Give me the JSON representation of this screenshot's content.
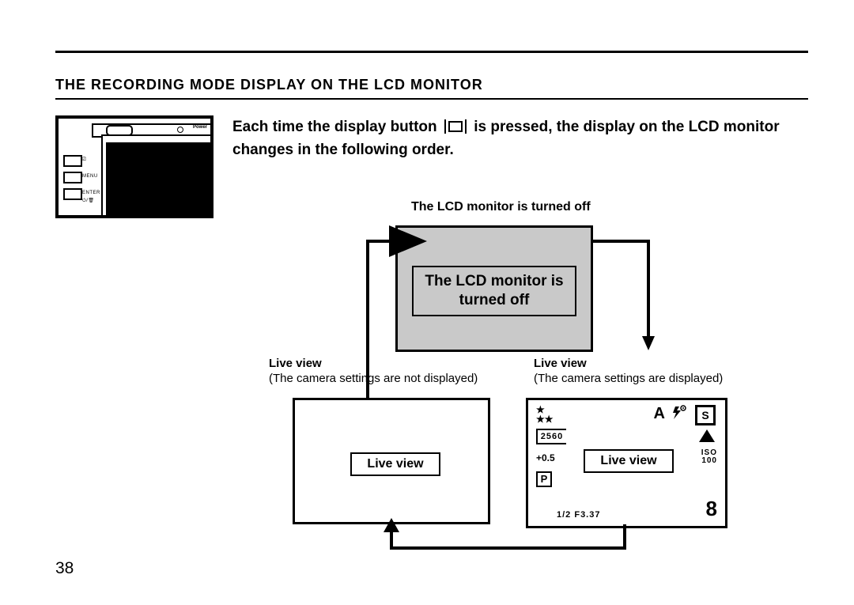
{
  "page_number": "38",
  "section_title": "THE RECORDING MODE DISPLAY ON THE LCD MONITOR",
  "intro_before": "Each time the display button",
  "intro_after": "is pressed, the display on the LCD monitor changes in the following order.",
  "camera": {
    "power_label": "Power",
    "btn_display": "",
    "btn_menu": "MENU",
    "btn_enter": "ENTER"
  },
  "diagram": {
    "caption_off": "The LCD monitor is turned off",
    "off_screen_label": "The LCD monitor is turned off",
    "left": {
      "title": "Live view",
      "sub": "(The camera settings are not displayed)",
      "live_label": "Live view"
    },
    "right": {
      "title": "Live view",
      "sub": "(The camera settings are displayed)"
    },
    "info_screen": {
      "res": "2560",
      "ev": "+0.5",
      "mode_p": "P",
      "exposure": "1/2 F3.37",
      "a": "A",
      "s": "S",
      "iso_label": "ISO",
      "iso_value": "100",
      "count": "8",
      "live_label": "Live view"
    }
  }
}
